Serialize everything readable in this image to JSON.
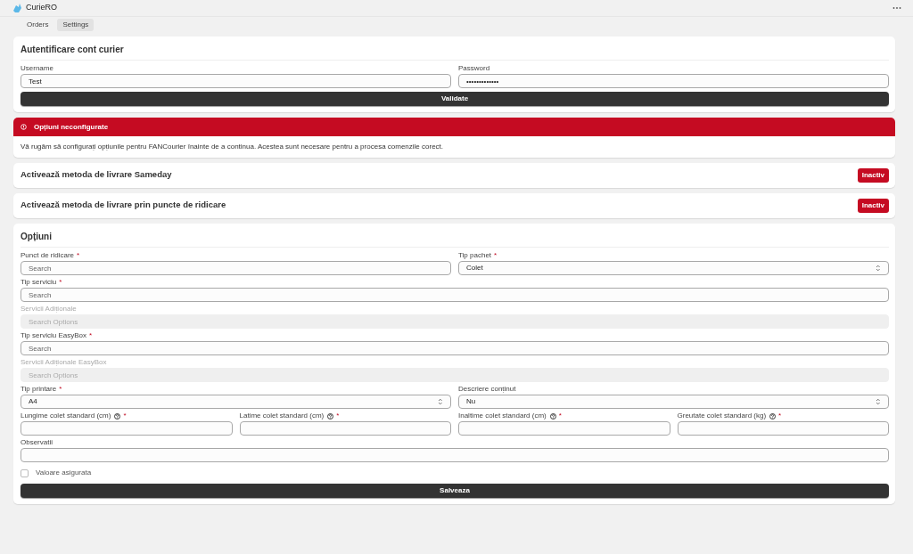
{
  "app": {
    "title": "CurieRO"
  },
  "tabs": [
    {
      "label": "Orders",
      "selected": false
    },
    {
      "label": "Settings",
      "selected": true
    }
  ],
  "auth": {
    "title": "Autentificare cont curier",
    "fields": [
      {
        "label": "Username",
        "value": "Test"
      },
      {
        "label": "Password",
        "value": "•••••••••••••"
      }
    ],
    "button": "Validate"
  },
  "alert": {
    "title": "Opțiuni neconfigurate",
    "message": "Vă rugăm să configurați opțiunile pentru FANCourier înainte de a continua. Acestea sunt necesare pentru a procesa comenzile corect."
  },
  "methods": [
    {
      "title": "Activează metoda de livrare Sameday",
      "status": "Inactiv",
      "on": false
    },
    {
      "title": "Activează metoda de livrare prin puncte de ridicare",
      "status": "Inactiv",
      "on": false
    }
  ],
  "options": {
    "title": "Opțiuni",
    "required_mark": "*",
    "rows": [
      [
        {
          "kind": "search",
          "label": "Punct de ridicare",
          "required": true,
          "placeholder": "Search"
        },
        {
          "kind": "select",
          "label": "Tip pachet",
          "required": true,
          "value": "Colet"
        }
      ],
      [
        {
          "kind": "search",
          "label": "Tip serviciu",
          "required": true,
          "placeholder": "Search"
        }
      ],
      [
        {
          "kind": "search",
          "label": "Servicii Adiționale",
          "disabled": true,
          "placeholder": "Search Options"
        }
      ],
      [
        {
          "kind": "search",
          "label": "Tip serviciu EasyBox",
          "required": true,
          "placeholder": "Search"
        }
      ],
      [
        {
          "kind": "search",
          "label": "Servicii Adiționale EasyBox",
          "disabled": true,
          "placeholder": "Search Options"
        }
      ],
      [
        {
          "kind": "select",
          "label": "Tip printare",
          "required": true,
          "value": "A4"
        },
        {
          "kind": "select",
          "label": "Descriere conținut",
          "value": "Nu"
        }
      ],
      [
        {
          "kind": "text",
          "label": "Lungime colet standard (cm)",
          "help": true,
          "required": true
        },
        {
          "kind": "text",
          "label": "Latime colet standard (cm)",
          "help": true,
          "required": true
        },
        {
          "kind": "text",
          "label": "Inaltime colet standard (cm)",
          "help": true,
          "required": true
        },
        {
          "kind": "text",
          "label": "Greutate colet standard (kg)",
          "help": true,
          "required": true
        }
      ],
      [
        {
          "kind": "text",
          "label": "Observatii"
        }
      ]
    ],
    "checkbox": {
      "label": "Valoare asigurata",
      "checked": false
    },
    "button": "Salveaza"
  }
}
